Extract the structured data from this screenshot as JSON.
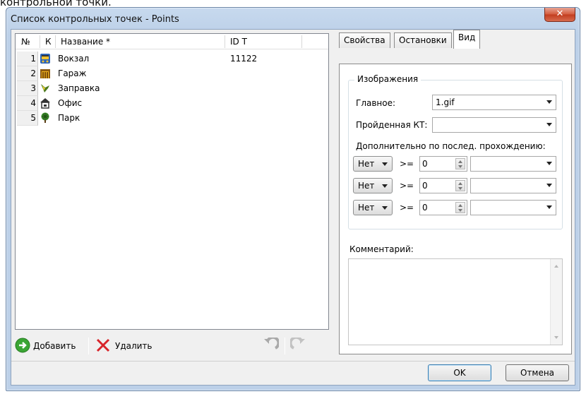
{
  "above_text": "контрольной точки.",
  "window": {
    "title": "Список контрольных точек - Points",
    "close_symbol": "✕"
  },
  "table": {
    "columns": [
      "№",
      "К",
      "Название *",
      "ID T"
    ],
    "rows": [
      {
        "num": "1",
        "icon": "bus-icon",
        "name": "Вокзал",
        "id": "11122"
      },
      {
        "num": "2",
        "icon": "garage-icon",
        "name": "Гараж",
        "id": ""
      },
      {
        "num": "3",
        "icon": "gas-pump-icon",
        "name": "Заправка",
        "id": ""
      },
      {
        "num": "4",
        "icon": "office-icon",
        "name": "Офис",
        "id": ""
      },
      {
        "num": "5",
        "icon": "tree-icon",
        "name": "Парк",
        "id": ""
      }
    ]
  },
  "toolbar": {
    "add_label": "Добавить",
    "delete_label": "Удалить"
  },
  "tabs": [
    "Свойства",
    "Остановки",
    "Вид"
  ],
  "view": {
    "group_title": "Изображения",
    "main_label": "Главное:",
    "main_value": "1.gif",
    "passed_label": "Пройденная КТ:",
    "passed_value": "",
    "extra_label": "Дополнительно по послед. прохождению:",
    "extra_rows": [
      {
        "combo": "Нет",
        "op": ">=",
        "num": "0",
        "image": ""
      },
      {
        "combo": "Нет",
        "op": ">=",
        "num": "0",
        "image": ""
      },
      {
        "combo": "Нет",
        "op": ">=",
        "num": "0",
        "image": ""
      }
    ],
    "comment_label": "Комментарий:"
  },
  "buttons": {
    "ok": "OK",
    "cancel": "Отмена"
  },
  "colors": {
    "title_gradient_top": "#c7d9ee",
    "close_button": "#c23d1f",
    "add_green": "#3aa534",
    "delete_red": "#d8242a"
  }
}
